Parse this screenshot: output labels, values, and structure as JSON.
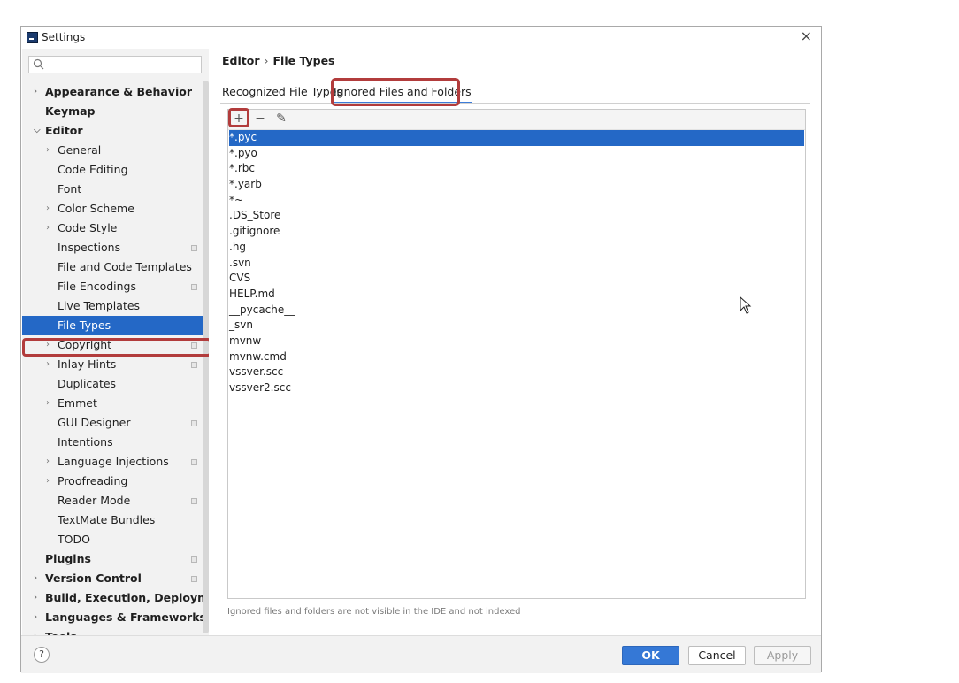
{
  "window": {
    "title": "Settings"
  },
  "sidebar": {
    "search_placeholder": "",
    "items": [
      {
        "label": "Appearance & Behavior",
        "level": 0,
        "bold": true,
        "chevron": "right"
      },
      {
        "label": "Keymap",
        "level": 0,
        "bold": true,
        "chevron": ""
      },
      {
        "label": "Editor",
        "level": 0,
        "bold": true,
        "chevron": "down"
      },
      {
        "label": "General",
        "level": 1,
        "chevron": "right"
      },
      {
        "label": "Code Editing",
        "level": 1,
        "chevron": ""
      },
      {
        "label": "Font",
        "level": 1,
        "chevron": ""
      },
      {
        "label": "Color Scheme",
        "level": 1,
        "chevron": "right"
      },
      {
        "label": "Code Style",
        "level": 1,
        "chevron": "right"
      },
      {
        "label": "Inspections",
        "level": 1,
        "chevron": "",
        "badge": true
      },
      {
        "label": "File and Code Templates",
        "level": 1,
        "chevron": ""
      },
      {
        "label": "File Encodings",
        "level": 1,
        "chevron": "",
        "badge": true
      },
      {
        "label": "Live Templates",
        "level": 1,
        "chevron": ""
      },
      {
        "label": "File Types",
        "level": 1,
        "chevron": "",
        "selected": true
      },
      {
        "label": "Copyright",
        "level": 1,
        "chevron": "right",
        "badge": true
      },
      {
        "label": "Inlay Hints",
        "level": 1,
        "chevron": "right",
        "badge": true
      },
      {
        "label": "Duplicates",
        "level": 1,
        "chevron": ""
      },
      {
        "label": "Emmet",
        "level": 1,
        "chevron": "right"
      },
      {
        "label": "GUI Designer",
        "level": 1,
        "chevron": "",
        "badge": true
      },
      {
        "label": "Intentions",
        "level": 1,
        "chevron": ""
      },
      {
        "label": "Language Injections",
        "level": 1,
        "chevron": "right",
        "badge": true
      },
      {
        "label": "Proofreading",
        "level": 1,
        "chevron": "right"
      },
      {
        "label": "Reader Mode",
        "level": 1,
        "chevron": "",
        "badge": true
      },
      {
        "label": "TextMate Bundles",
        "level": 1,
        "chevron": ""
      },
      {
        "label": "TODO",
        "level": 1,
        "chevron": ""
      },
      {
        "label": "Plugins",
        "level": 0,
        "bold": true,
        "chevron": "",
        "badge": true
      },
      {
        "label": "Version Control",
        "level": 0,
        "bold": true,
        "chevron": "right",
        "badge": true
      },
      {
        "label": "Build, Execution, Deployment",
        "level": 0,
        "bold": true,
        "chevron": "right"
      },
      {
        "label": "Languages & Frameworks",
        "level": 0,
        "bold": true,
        "chevron": "right"
      },
      {
        "label": "Tools",
        "level": 0,
        "bold": true,
        "chevron": "right"
      }
    ]
  },
  "breadcrumb": {
    "part1": "Editor",
    "separator": "›",
    "part2": "File Types"
  },
  "tabs": [
    {
      "label": "Recognized File Types",
      "active": false
    },
    {
      "label": "Ignored Files and Folders",
      "active": true
    }
  ],
  "toolbar": {
    "add": "+",
    "remove": "−",
    "edit": "✎"
  },
  "ignored_list": [
    "*.pyc",
    "*.pyo",
    "*.rbc",
    "*.yarb",
    "*~",
    ".DS_Store",
    ".gitignore",
    ".hg",
    ".svn",
    "CVS",
    "HELP.md",
    "__pycache__",
    "_svn",
    "mvnw",
    "mvnw.cmd",
    "vssver.scc",
    "vssver2.scc"
  ],
  "selected_index": 0,
  "footnote": "Ignored files and folders are not visible in the IDE and not indexed",
  "buttons": {
    "help": "?",
    "ok": "OK",
    "cancel": "Cancel",
    "apply": "Apply"
  },
  "colors": {
    "selection": "#2468c6",
    "highlight": "#b23c3c",
    "primary_button": "#3578d6"
  }
}
